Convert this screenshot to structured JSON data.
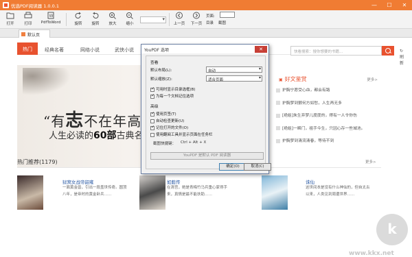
{
  "titlebar": {
    "title": "优选PDF阅读器 1.0.0.1"
  },
  "toolbar": {
    "open": "打开",
    "print": "打印",
    "pdf2word": "PdfToWord",
    "undo": "旋转",
    "redo": "旋转",
    "zoom_in": "放大",
    "zoom_out": "缩小",
    "prev": "上一页",
    "next": "下一页",
    "page_label": "页面:",
    "bookmark": "目录",
    "screenshot": "截图"
  },
  "tab": {
    "label": "默认页"
  },
  "nav": {
    "items": [
      "热门",
      "经典名著",
      "网络小说",
      "武侠小说"
    ],
    "search_placeholder": "快看搜索：搜你想要的书籍...",
    "refresh": "刷新"
  },
  "banner": {
    "line1a": "“有",
    "line1b": "志",
    "line1c": "不在年高，",
    "line2a": "人生必读的",
    "line2b": "60部",
    "line2c": "古典名著"
  },
  "rightpanel": {
    "title": "好文鉴赏",
    "more": "更多>",
    "items": [
      "护胸宁愿受心血，都会有路",
      "护胸梦到颤何方如愁，人生再无多",
      "[绝姐]朱生弃梦儿度度的，得有一人令你伤",
      "[绝姐]一瞬门，祖手今生，只因心存一些城池。",
      "护胸梦到清流清春，等待不到"
    ]
  },
  "section": {
    "title": "热门推荐(1179)",
    "more": "更多>"
  },
  "books": [
    {
      "title": "狱窝女战帝韶雍",
      "desc": "一面黄金兽，引出一段盖世传奇。圆顶八年，是帝时的黄金卧兵……"
    },
    {
      "title": "如懿传",
      "desc": "在清宫，她是青梅竹马兵重心家得手来，真情是最不能扶助……"
    },
    {
      "title": "诛仙",
      "desc": "这世间本是没有什么神仙的，但自太古以来，人类见到周遭世界……"
    }
  ],
  "dialog": {
    "title": "YouPDF 选项",
    "group_view": "查看",
    "default_layout_label": "默认布局(L):",
    "default_layout_value": "自动",
    "default_zoom_label": "默认缩放(Z):",
    "default_zoom_value": "适合页面",
    "opt_bookmark": "可用时显示目录选框(B)",
    "opt_remember": "为每一个文档记住选项",
    "group_advanced": "高级",
    "opt_tabs": "使用页签(T)",
    "opt_autoupdate": "自动检查更新(U)",
    "opt_remember_files": "记住打开的文件(O)",
    "opt_toolbar": "使用翻阅工具并显示页面在任务栏",
    "hotkey_label": "截图快捷键：",
    "hotkey_value": "Ctrl + Alt + X",
    "default_reader": "YouPDF 是默认 PDF 阅读器",
    "ok": "确定(O)",
    "cancel": "取消(C)"
  },
  "watermark": {
    "text": "www.kkx.net",
    "badge": "k"
  },
  "colors": {
    "accent": "#f07c33",
    "nav_active": "#e8522f"
  }
}
